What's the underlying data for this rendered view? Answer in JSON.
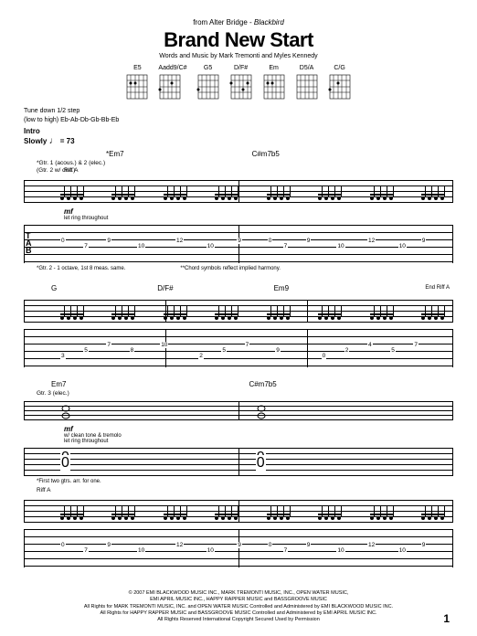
{
  "header": {
    "from_prefix": "from Alter Bridge - ",
    "album": "Blackbird",
    "title": "Brand New Start",
    "credits": "Words and Music by Mark Tremonti and Myles Kennedy"
  },
  "chord_diagrams": [
    "E5",
    "Aadd9/C#",
    "G5",
    "D/F#",
    "Em",
    "D5/A",
    "C/G"
  ],
  "tuning": {
    "line1": "Tune down 1/2 step",
    "line2": "(low to high) Eb-Ab-Db-Gb-Bb-Eb"
  },
  "intro": {
    "label": "Intro",
    "tempo_prefix": "Slowly ",
    "tempo_note": "♩",
    "tempo_value": " = 73"
  },
  "system1": {
    "chord1": "*Em7",
    "chord2": "C#m7b5",
    "gtr_label": "*Gtr. 1 (acous.) & 2 (elec.)",
    "sub_label": "(Gtr. 2 w/ dist.)",
    "riff": "Riff A",
    "dyn": "mf",
    "perf_note": "let ring throughout",
    "foot1": "*Gtr. 2 - 1 octave, 1st 8 meas. same.",
    "foot2": "**Chord symbols reflect implied harmony.",
    "tab_nums": [
      {
        "v": "0",
        "l": 0,
        "t": 8
      },
      {
        "v": "7",
        "l": 6,
        "t": 14
      },
      {
        "v": "9",
        "l": 12,
        "t": 8
      },
      {
        "v": "10",
        "l": 20,
        "t": 14
      },
      {
        "v": "12",
        "l": 30,
        "t": 8
      },
      {
        "v": "10",
        "l": 38,
        "t": 14
      },
      {
        "v": "9",
        "l": 46,
        "t": 8
      },
      {
        "v": "0",
        "l": 54,
        "t": 8
      },
      {
        "v": "7",
        "l": 58,
        "t": 14
      },
      {
        "v": "9",
        "l": 64,
        "t": 8
      },
      {
        "v": "10",
        "l": 72,
        "t": 14
      },
      {
        "v": "12",
        "l": 80,
        "t": 8
      },
      {
        "v": "10",
        "l": 88,
        "t": 14
      },
      {
        "v": "9",
        "l": 94,
        "t": 8
      }
    ]
  },
  "system2": {
    "chord1": "G",
    "chord2": "D/F#",
    "chord3": "Em9",
    "end_riff": "End Riff A",
    "tab_nums": [
      {
        "v": "3",
        "l": 0,
        "t": 20
      },
      {
        "v": "5",
        "l": 6,
        "t": 14
      },
      {
        "v": "7",
        "l": 12,
        "t": 8
      },
      {
        "v": "8",
        "l": 18,
        "t": 14
      },
      {
        "v": "10",
        "l": 26,
        "t": 8
      },
      {
        "v": "2",
        "l": 36,
        "t": 20
      },
      {
        "v": "5",
        "l": 42,
        "t": 14
      },
      {
        "v": "7",
        "l": 48,
        "t": 8
      },
      {
        "v": "9",
        "l": 56,
        "t": 14
      },
      {
        "v": "0",
        "l": 68,
        "t": 20
      },
      {
        "v": "2",
        "l": 74,
        "t": 14
      },
      {
        "v": "4",
        "l": 80,
        "t": 8
      },
      {
        "v": "5",
        "l": 86,
        "t": 14
      },
      {
        "v": "7",
        "l": 92,
        "t": 8
      }
    ]
  },
  "system3": {
    "chord1": "Em7",
    "chord2": "C#m7b5",
    "gtr3_label": "Gtr. 3 (elec.)",
    "dyn": "mf",
    "perf1": "w/ clean tone & tremolo",
    "perf2": "let ring throughout",
    "gtr12_note": "*First two gtrs. arr. for one.",
    "riff_label": "Riff A"
  },
  "footer": {
    "line1": "© 2007 EMI BLACKWOOD MUSIC INC., MARK TREMONTI MUSIC, INC., OPEN WATER MUSIC,",
    "line2": "EMI APRIL MUSIC INC., HAPPY RAPPER MUSIC and BASSGROOVE MUSIC",
    "line3": "All Rights for MARK TREMONTI MUSIC, INC. and OPEN WATER MUSIC Controlled and Administered by EMI BLACKWOOD MUSIC INC.",
    "line4": "All Rights for HAPPY RAPPER MUSIC and BASSGROOVE MUSIC Controlled and Administered by EMI APRIL MUSIC INC.",
    "line5": "All Rights Reserved   International Copyright Secured   Used by Permission"
  },
  "page_number": "1"
}
